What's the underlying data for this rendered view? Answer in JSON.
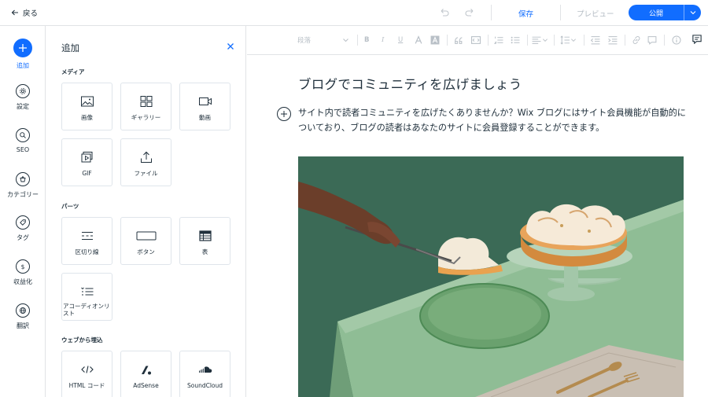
{
  "topbar": {
    "back_label": "戻る",
    "save_label": "保存",
    "preview_label": "プレビュー",
    "publish_label": "公開"
  },
  "rail": {
    "items": [
      {
        "label": "追加",
        "icon": "plus-icon"
      },
      {
        "label": "設定",
        "icon": "gear-icon"
      },
      {
        "label": "SEO",
        "icon": "search-icon"
      },
      {
        "label": "カテゴリー",
        "icon": "category-icon"
      },
      {
        "label": "タグ",
        "icon": "tag-icon"
      },
      {
        "label": "収益化",
        "icon": "dollar-icon"
      },
      {
        "label": "翻訳",
        "icon": "globe-icon"
      }
    ]
  },
  "panel": {
    "title": "追加",
    "sections": {
      "media": "メディア",
      "parts": "パーツ",
      "embed": "ウェブから埋込"
    },
    "media": [
      {
        "label": "画像",
        "icon": "image-icon"
      },
      {
        "label": "ギャラリー",
        "icon": "gallery-icon"
      },
      {
        "label": "動画",
        "icon": "video-icon"
      },
      {
        "label": "GIF",
        "icon": "gif-icon"
      },
      {
        "label": "ファイル",
        "icon": "upload-icon"
      }
    ],
    "parts": [
      {
        "label": "区切り線",
        "icon": "divider-icon"
      },
      {
        "label": "ボタン",
        "icon": "button-icon"
      },
      {
        "label": "表",
        "icon": "table-icon"
      },
      {
        "label": "アコーディオンリスト",
        "icon": "accordion-icon"
      }
    ],
    "embed": [
      {
        "label": "HTML コード",
        "icon": "code-icon"
      },
      {
        "label": "AdSense",
        "icon": "adsense-icon"
      },
      {
        "label": "SoundCloud",
        "icon": "soundcloud-icon"
      }
    ]
  },
  "toolbar": {
    "paragraph_select": "段落"
  },
  "post": {
    "title": "ブログでコミュニティを広げましょう",
    "body": "サイト内で読者コミュニティを広げたくありませんか？Wix ブログにはサイト会員機能が自動的についており、ブログの読者はあなたのサイトに会員登録することができます。"
  },
  "colors": {
    "accent": "#116dff",
    "text": "#20303c",
    "border": "#dfe5eb"
  }
}
